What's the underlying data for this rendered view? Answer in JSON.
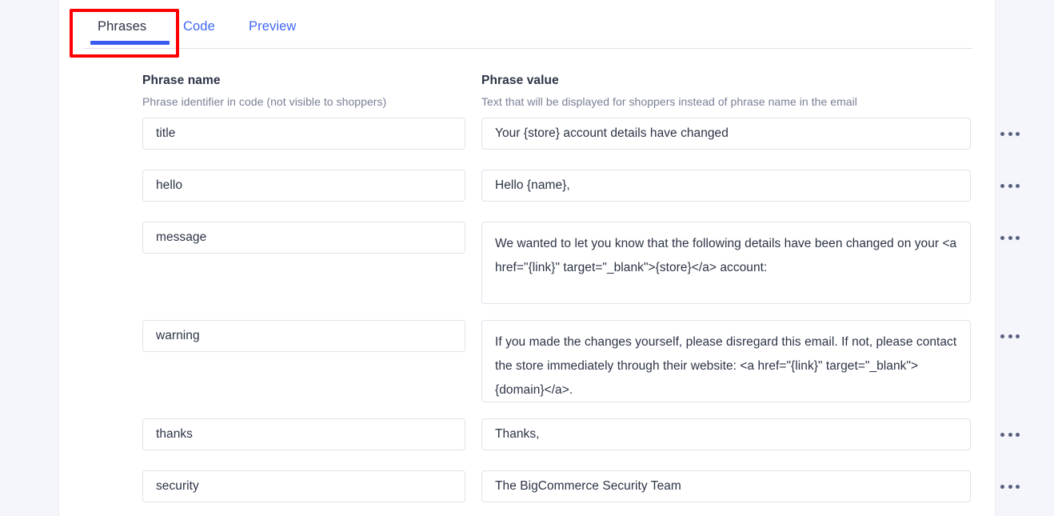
{
  "tabs": [
    {
      "label": "Phrases",
      "state": "active"
    },
    {
      "label": "Code",
      "state": "inactive"
    },
    {
      "label": "Preview",
      "state": "inactive"
    }
  ],
  "columns": {
    "name": {
      "title": "Phrase name",
      "subtitle": "Phrase identifier in code (not visible to shoppers)"
    },
    "value": {
      "title": "Phrase value",
      "subtitle": "Text that will be displayed for shoppers instead of phrase name in the email"
    }
  },
  "rows": [
    {
      "name": "title",
      "value": "Your {store} account details have changed",
      "multiline": false,
      "menu": "row-menu"
    },
    {
      "name": "hello",
      "value": "Hello {name},",
      "multiline": false,
      "menu": "row-menu"
    },
    {
      "name": "message",
      "value": "We wanted to let you know that the following details have been changed on your <a href=\"{link}\" target=\"_blank\">{store}</a> account:",
      "multiline": true,
      "menu": "row-menu"
    },
    {
      "name": "warning",
      "value": "If you made the changes yourself, please disregard this email. If not, please contact the store immediately through their website: <a href=\"{link}\" target=\"_blank\">{domain}</a>.",
      "multiline": true,
      "menu": "row-menu"
    },
    {
      "name": "thanks",
      "value": "Thanks,",
      "multiline": false,
      "menu": "row-menu"
    },
    {
      "name": "security",
      "value": "The BigCommerce Security Team",
      "multiline": false,
      "menu": "row-menu"
    }
  ],
  "annotation": {
    "type": "highlight-box",
    "color": "#ff0000",
    "targets": "tab-phrases"
  },
  "colors": {
    "accent": "#3a5bf0",
    "link": "#4168f5",
    "text": "#2b3345",
    "muted": "#7a8096",
    "border": "#e0e3ec",
    "page_bg": "#f4f6fb",
    "card_bg": "#ffffff",
    "dots": "#5a6180"
  }
}
